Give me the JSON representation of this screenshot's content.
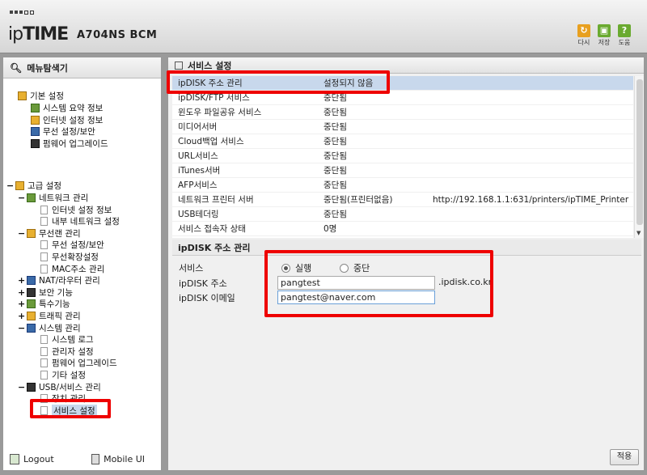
{
  "header": {
    "brand_prefix": "ip",
    "brand_bold": "TIME",
    "model": "A704NS BCM",
    "buttons": [
      {
        "label": "다시",
        "icon": "refresh-icon",
        "color": "#e8a020",
        "glyph": "↻"
      },
      {
        "label": "저장",
        "icon": "save-icon",
        "color": "#6aaa30",
        "glyph": "▣"
      },
      {
        "label": "도움",
        "icon": "help-icon",
        "color": "#6aaa30",
        "glyph": "?"
      }
    ]
  },
  "sidebar": {
    "title": "메뉴탐색기",
    "basic": {
      "label": "기본 설정",
      "items": [
        "시스템 요약 정보",
        "인터넷 설정 정보",
        "무선 설정/보안",
        "펌웨어 업그레이드"
      ]
    },
    "advanced": {
      "label": "고급 설정",
      "groups": [
        {
          "label": "네트워크 관리",
          "expander": "−",
          "items": [
            "인터넷 설정 정보",
            "내부 네트워크 설정"
          ]
        },
        {
          "label": "무선랜 관리",
          "expander": "−",
          "items": [
            "무선 설정/보안",
            "무선확장설정",
            "MAC주소 관리"
          ]
        },
        {
          "label": "NAT/라우터 관리",
          "expander": "+",
          "items": []
        },
        {
          "label": "보안 기능",
          "expander": "+",
          "items": []
        },
        {
          "label": "특수기능",
          "expander": "+",
          "items": []
        },
        {
          "label": "트래픽 관리",
          "expander": "+",
          "items": []
        },
        {
          "label": "시스템 관리",
          "expander": "−",
          "items": [
            "시스템 로그",
            "관리자 설정",
            "펌웨어 업그레이드",
            "기타 설정"
          ]
        },
        {
          "label": "USB/서비스 관리",
          "expander": "−",
          "items": [
            "장치 관리",
            "서비스 설정"
          ]
        }
      ]
    },
    "logout": "Logout",
    "mobile": "Mobile UI"
  },
  "main": {
    "title": "서비스 설정",
    "services": [
      {
        "name": "ipDISK 주소 관리",
        "status": "설정되지 않음",
        "extra": ""
      },
      {
        "name": "ipDISK/FTP 서비스",
        "status": "중단됨",
        "extra": ""
      },
      {
        "name": "윈도우 파일공유 서비스",
        "status": "중단됨",
        "extra": ""
      },
      {
        "name": "미디어서버",
        "status": "중단됨",
        "extra": ""
      },
      {
        "name": "Cloud백업 서비스",
        "status": "중단됨",
        "extra": ""
      },
      {
        "name": "URL서비스",
        "status": "중단됨",
        "extra": ""
      },
      {
        "name": "iTunes서버",
        "status": "중단됨",
        "extra": ""
      },
      {
        "name": "AFP서비스",
        "status": "중단됨",
        "extra": ""
      },
      {
        "name": "네트워크 프린터 서버",
        "status": "중단됨(프린터없음)",
        "extra": "http://192.168.1.1:631/printers/ipTIME_Printer"
      },
      {
        "name": "USB테더링",
        "status": "중단됨",
        "extra": ""
      },
      {
        "name": "서비스 접속자 상태",
        "status": "0명",
        "extra": ""
      }
    ],
    "detail": {
      "title": "ipDISK 주소 관리",
      "service_label": "서비스",
      "run_label": "실행",
      "stop_label": "중단",
      "selected": "실행",
      "address_label": "ipDISK 주소",
      "address_value": "pangtest",
      "domain_suffix": ".ipdisk.co.kr",
      "email_label": "ipDISK 이메일",
      "email_value": "pangtest@naver.com"
    },
    "apply_label": "적용"
  }
}
